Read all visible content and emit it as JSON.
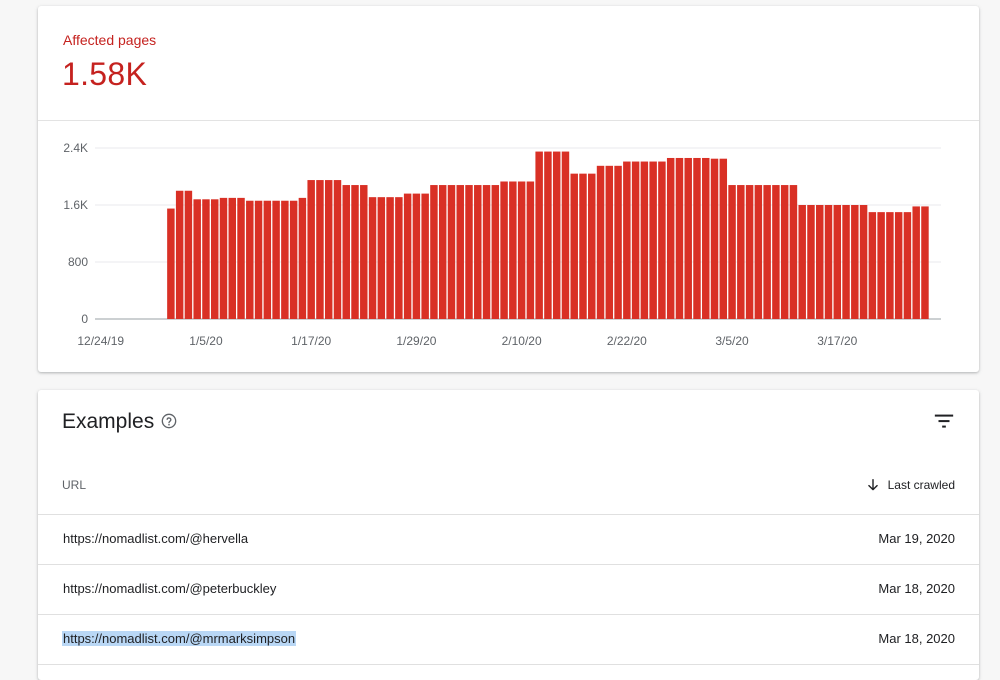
{
  "summary": {
    "label": "Affected pages",
    "value": "1.58K",
    "accent_color": "#c5221f"
  },
  "chart_data": {
    "type": "bar",
    "color": "#d93025",
    "grid": true,
    "ylim": [
      0,
      2400
    ],
    "y_ticks": [
      "0",
      "800",
      "1.6K",
      "2.4K"
    ],
    "y_tick_values": [
      0,
      800,
      1600,
      2400
    ],
    "x_tick_labels": [
      "12/24/19",
      "1/5/20",
      "1/17/20",
      "1/29/20",
      "2/10/20",
      "2/22/20",
      "3/5/20",
      "3/17/20"
    ],
    "start_date": "12/24/19",
    "values": [
      0,
      0,
      0,
      0,
      0,
      0,
      0,
      0,
      1550,
      1800,
      1800,
      1680,
      1680,
      1680,
      1700,
      1700,
      1700,
      1660,
      1660,
      1660,
      1660,
      1660,
      1660,
      1700,
      1950,
      1950,
      1950,
      1950,
      1880,
      1880,
      1880,
      1710,
      1710,
      1710,
      1710,
      1760,
      1760,
      1760,
      1880,
      1880,
      1880,
      1880,
      1880,
      1880,
      1880,
      1880,
      1930,
      1930,
      1930,
      1930,
      2350,
      2350,
      2350,
      2350,
      2040,
      2040,
      2040,
      2150,
      2150,
      2150,
      2210,
      2210,
      2210,
      2210,
      2210,
      2260,
      2260,
      2260,
      2260,
      2260,
      2250,
      2250,
      1880,
      1880,
      1880,
      1880,
      1880,
      1880,
      1880,
      1880,
      1600,
      1600,
      1600,
      1600,
      1600,
      1600,
      1600,
      1600,
      1500,
      1500,
      1500,
      1500,
      1500,
      1580,
      1580
    ]
  },
  "examples": {
    "title": "Examples",
    "help_icon": "help-circle-icon",
    "filter_icon": "filter-list-icon",
    "columns": {
      "url": "URL",
      "last_crawled": "Last crawled"
    },
    "rows": [
      {
        "url": "https://nomadlist.com/@hervella",
        "date": "Mar 19, 2020",
        "selected": false
      },
      {
        "url": "https://nomadlist.com/@peterbuckley",
        "date": "Mar 18, 2020",
        "selected": false
      },
      {
        "url": "https://nomadlist.com/@mrmarksimpson",
        "date": "Mar 18, 2020",
        "selected": true
      }
    ]
  }
}
